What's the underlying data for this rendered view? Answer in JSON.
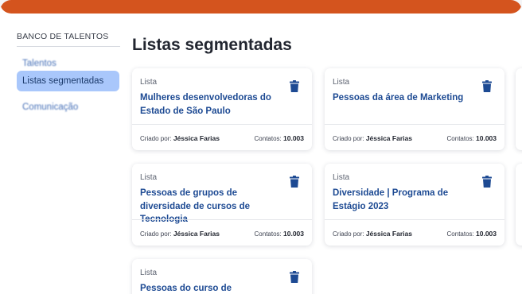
{
  "theme": {
    "accent": "#d4541e",
    "active_nav": "#a9c7fb",
    "link": "#1d4a93"
  },
  "sidebar": {
    "header": "BANCO DE TALENTOS",
    "items": [
      {
        "label": "Talentos"
      },
      {
        "label": "Listas segmentadas"
      },
      {
        "label": "Comunicação"
      }
    ]
  },
  "main": {
    "title": "Listas segmentadas",
    "cards": [
      {
        "type": "Lista",
        "title": "Mulheres desenvolvedoras do Estado de São Paulo",
        "creator_label": "Criado por:",
        "creator": "Jéssica Farias",
        "contacts_label": "Contatos:",
        "contacts": "10.003"
      },
      {
        "type": "Lista",
        "title": "Pessoas da área de Marketing",
        "creator_label": "Criado por:",
        "creator": "Jéssica Farias",
        "contacts_label": "Contatos:",
        "contacts": "10.003"
      },
      {
        "type": "Lista",
        "title": "Pessoas de grupos de diversidade de cursos de Tecnologia",
        "creator_label": "Criado por:",
        "creator": "Jéssica Farias",
        "contacts_label": "Contatos:",
        "contacts": "10.003"
      },
      {
        "type": "Lista",
        "title": "Diversidade | Programa de Estágio 2023",
        "creator_label": "Criado por:",
        "creator": "Jéssica Farias",
        "contacts_label": "Contatos:",
        "contacts": "10.003"
      },
      {
        "type": "Lista",
        "title": "Pessoas do curso de Engenharia da",
        "creator_label": "",
        "creator": "",
        "contacts_label": "",
        "contacts": ""
      }
    ]
  },
  "icons": {
    "delete": "trash-icon"
  }
}
